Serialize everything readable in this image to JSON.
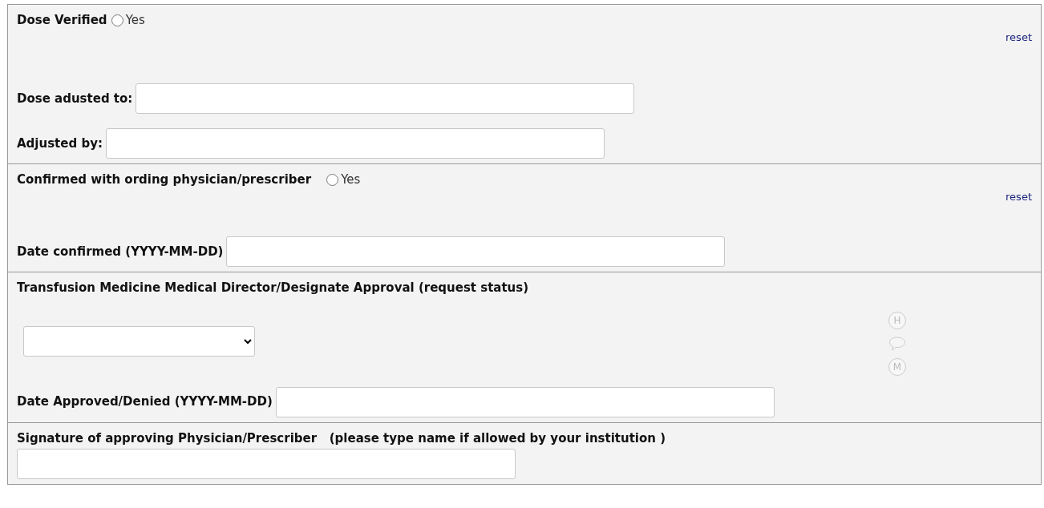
{
  "sections": [
    {
      "kind": "radio",
      "label": "Dose Verified",
      "option": {
        "label": "Yes",
        "selected": false
      },
      "reset": "reset",
      "fields": [
        {
          "label": "Dose adusted to:"
        },
        {
          "label": "Adjusted by:"
        }
      ]
    },
    {
      "kind": "radio",
      "label": "Confirmed with ording physician/prescriber",
      "option": {
        "label": "Yes",
        "selected": false
      },
      "reset": "reset",
      "fields": [
        {
          "label": "Date confirmed (YYYY-MM-DD)"
        }
      ]
    },
    {
      "kind": "select",
      "label": "Transfusion Medicine Medical Director/Designate Approval (request status)",
      "icons": [
        {
          "kind": "letter",
          "text": "H"
        },
        {
          "kind": "comment"
        },
        {
          "kind": "letter",
          "text": "M"
        }
      ],
      "fields": [
        {
          "label": "Date Approved/Denied (YYYY-MM-DD)"
        }
      ]
    },
    {
      "kind": "stacked",
      "label": "Signature of approving Physician/Prescriber   (please type name if allowed by your institution )"
    }
  ]
}
